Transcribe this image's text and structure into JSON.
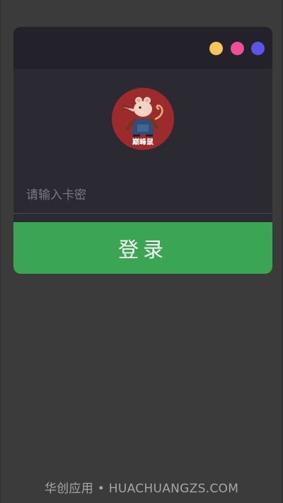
{
  "window": {
    "dots": [
      {
        "name": "yellow-dot",
        "color": "#f7c65a"
      },
      {
        "name": "pink-dot",
        "color": "#ee4f97"
      },
      {
        "name": "purple-dot",
        "color": "#5a55e6"
      }
    ]
  },
  "logo": {
    "icon": "rat-mascot-logo",
    "text": "巅峰鼠",
    "bg_color": "#9e2b2b"
  },
  "login": {
    "input_placeholder": "请输入卡密",
    "input_value": "",
    "button_label": "登录",
    "button_color": "#3aa653"
  },
  "footer": {
    "text": "华创应用 • HUACHUANGZS.COM"
  }
}
